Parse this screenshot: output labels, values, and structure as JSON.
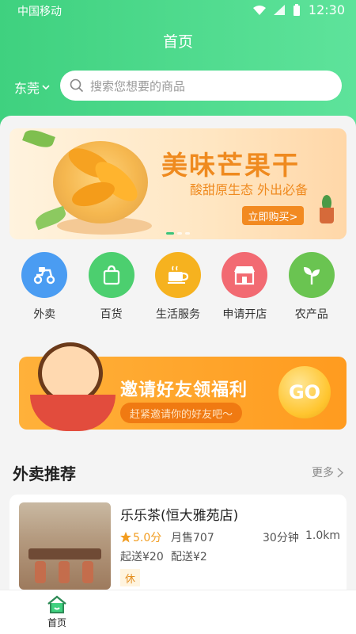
{
  "status_bar": {
    "carrier": "中国移动",
    "time": "12:30"
  },
  "header": {
    "title": "首页",
    "city": "东莞"
  },
  "search": {
    "placeholder": "搜索您想要的商品"
  },
  "banner": {
    "title": "美味芒果干",
    "subtitle": "酸甜原生态 外出必备",
    "button": "立即购买>"
  },
  "categories": [
    {
      "label": "外卖",
      "icon": "scooter-icon",
      "color": "#4a9cf2"
    },
    {
      "label": "百货",
      "icon": "shopping-bag-icon",
      "color": "#4ccf6f"
    },
    {
      "label": "生活服务",
      "icon": "coffee-cup-icon",
      "color": "#f6b21f"
    },
    {
      "label": "申请开店",
      "icon": "store-icon",
      "color": "#f26a72"
    },
    {
      "label": "农产品",
      "icon": "sprout-icon",
      "color": "#6ac451"
    }
  ],
  "invite": {
    "title": "邀请好友领福利",
    "subtitle": "赶紧邀请你的好友吧～",
    "go": "GO"
  },
  "section": {
    "title": "外卖推荐",
    "more": "更多"
  },
  "store": {
    "name": "乐乐茶(恒大雅苑店)",
    "rating": "5.0分",
    "sales": "月售707",
    "time": "30分钟",
    "distance": "1.0km",
    "min_order": "起送¥20",
    "delivery_fee": "配送¥2",
    "tag": "休"
  },
  "tabbar": {
    "home": "首页"
  },
  "colors": {
    "brand_green": "#3fd17f",
    "accent_orange": "#ef8a1f"
  }
}
